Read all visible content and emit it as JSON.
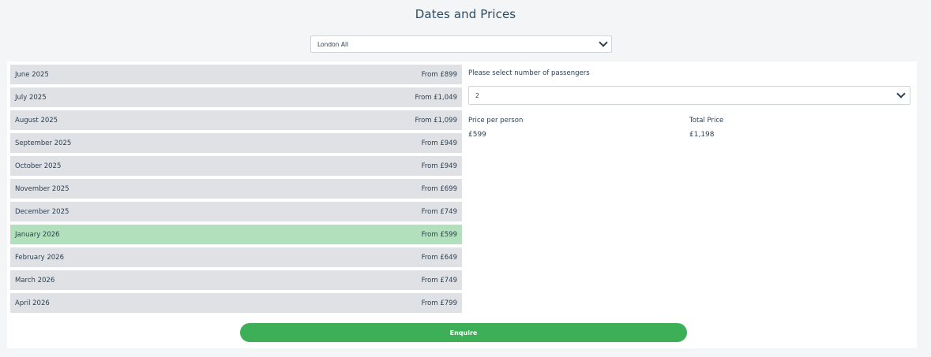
{
  "page": {
    "title": "Dates and Prices"
  },
  "route_select": {
    "value": "London All",
    "icon": "chevron-down-icon"
  },
  "months": [
    {
      "name": "June 2025",
      "price": "From £899",
      "selected": false
    },
    {
      "name": "July 2025",
      "price": "From £1,049",
      "selected": false
    },
    {
      "name": "August 2025",
      "price": "From £1,099",
      "selected": false
    },
    {
      "name": "September 2025",
      "price": "From £949",
      "selected": false
    },
    {
      "name": "October 2025",
      "price": "From £949",
      "selected": false
    },
    {
      "name": "November 2025",
      "price": "From £699",
      "selected": false
    },
    {
      "name": "December 2025",
      "price": "From £749",
      "selected": false
    },
    {
      "name": "January 2026",
      "price": "From £599",
      "selected": true
    },
    {
      "name": "February 2026",
      "price": "From £649",
      "selected": false
    },
    {
      "name": "March 2026",
      "price": "From £749",
      "selected": false
    },
    {
      "name": "April 2026",
      "price": "From £799",
      "selected": false
    }
  ],
  "passengers": {
    "label": "Please select number of passengers",
    "value": "2"
  },
  "pricing": {
    "per_person_label": "Price per person",
    "per_person_value": "£599",
    "total_label": "Total Price",
    "total_value": "£1,198"
  },
  "enquire": {
    "label": "Enquire"
  },
  "colors": {
    "background": "#f4f5f7",
    "row": "#dfe1e4",
    "row_selected": "#b2dfbc",
    "button": "#3daf57",
    "text": "#2b3f52"
  }
}
